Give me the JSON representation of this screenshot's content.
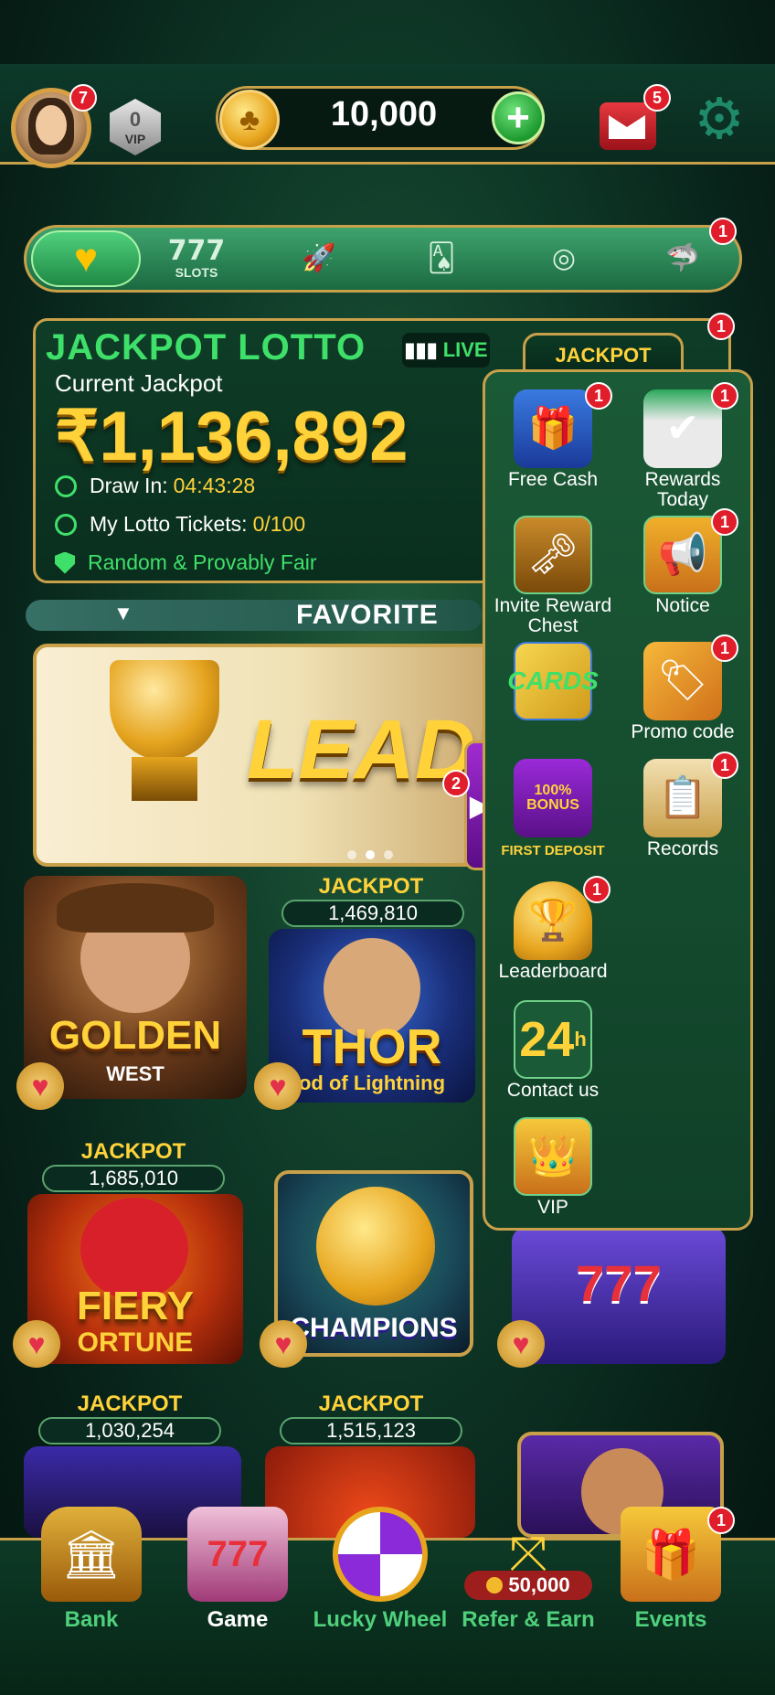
{
  "header": {
    "avatar_badge": "7",
    "vip_level": "0",
    "vip_label": "VIP",
    "coin_symbol": "♣",
    "coin_balance": "10,000",
    "mail_badge": "5"
  },
  "categories": {
    "active_icon": "heart-icon",
    "slots_big": "777",
    "slots_small": "SLOTS",
    "crash_icon": "rocket-icon",
    "cards_icon": "playing-cards-icon",
    "roulette_icon": "roulette-icon",
    "fish_icon": "shark-icon",
    "fish_badge": "1"
  },
  "lotto": {
    "title": "JACKPOT LOTTO",
    "live": "LIVE",
    "current_label": "Current Jackpot",
    "amount": "₹1,136,892",
    "draw_label": "Draw In:",
    "draw_time": "04:43:28",
    "tickets_label": "My Lotto Tickets:",
    "tickets_value": "0/100",
    "fair_label": "Random & Provably Fair",
    "jackpot_tab": "JACKPOT",
    "card_badge": "1"
  },
  "favorite": {
    "label": "FAVORITE"
  },
  "banner": {
    "title": "LEADER",
    "handle_badge": "2"
  },
  "games": {
    "golden_west": {
      "name": "GOLDEN",
      "sub": "WEST"
    },
    "thor": {
      "jackpot_label": "JACKPOT",
      "jackpot_value": "1,469,810",
      "name": "THOR",
      "sub": "od of Lightning"
    },
    "fiery": {
      "jackpot_label": "JACKPOT",
      "jackpot_value": "1,685,010",
      "name": "FIERY",
      "sub": "ORTUNE"
    },
    "champions": {
      "name": "CHAMPIONS"
    },
    "slot777": {
      "reels": "777"
    },
    "row4_a": {
      "jackpot_label": "JACKPOT",
      "jackpot_value": "1,030,254"
    },
    "row4_b": {
      "jackpot_label": "JACKPOT",
      "jackpot_value": "1,515,123"
    }
  },
  "side_menu": {
    "items": [
      {
        "label": "Free Cash",
        "badge": "1"
      },
      {
        "label": "Rewards Today",
        "badge": "1"
      },
      {
        "label": "Invite Reward Chest",
        "badge": ""
      },
      {
        "label": "Notice",
        "badge": "1"
      },
      {
        "label": "CARDS",
        "badge": ""
      },
      {
        "label": "Promo code",
        "badge": "1"
      },
      {
        "label": "FIRST DEPOSIT",
        "badge": ""
      },
      {
        "label": "Records",
        "badge": "1"
      },
      {
        "label": "Leaderboard",
        "badge": "1"
      },
      {
        "label": "Contact us",
        "badge": ""
      },
      {
        "label": "VIP",
        "badge": ""
      }
    ],
    "deposit_big": "100%",
    "deposit_mid": "BONUS",
    "contact_big": "24",
    "contact_small": "h"
  },
  "bottom_nav": {
    "bank": "Bank",
    "game": "Game",
    "lucky_wheel": "Lucky Wheel",
    "refer_amount": "50,000",
    "refer": "Refer & Earn",
    "events": "Events",
    "events_badge": "1"
  },
  "colors": {
    "accent_gold": "#c9a04a",
    "jackpot_yellow": "#ffd23a",
    "live_green": "#3fe06a",
    "badge_red": "#e01d2a"
  }
}
